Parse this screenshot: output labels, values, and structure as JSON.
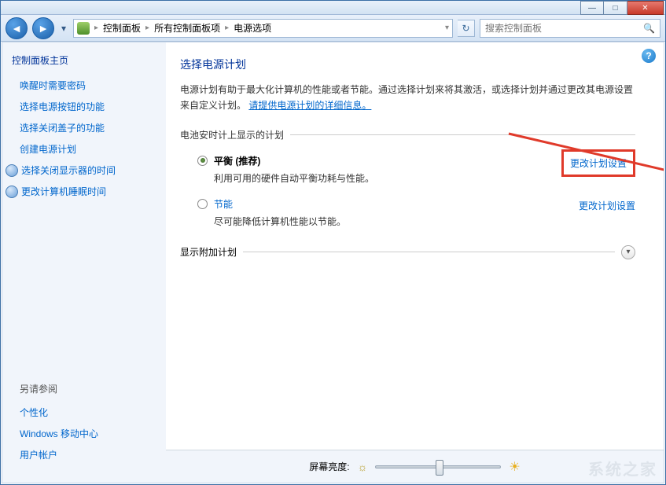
{
  "titlebar": {
    "min_tip": "最小化",
    "max_tip": "最大化",
    "close_tip": "关闭"
  },
  "nav": {
    "back_tip": "后退",
    "fwd_tip": "前进",
    "crumb1": "控制面板",
    "crumb2": "所有控制面板项",
    "crumb3": "电源选项",
    "search_placeholder": "搜索控制面板"
  },
  "sidebar": {
    "home": "控制面板主页",
    "links": [
      "唤醒时需要密码",
      "选择电源按钮的功能",
      "选择关闭盖子的功能",
      "创建电源计划",
      "选择关闭显示器的时间",
      "更改计算机睡眠时间"
    ],
    "seealso_title": "另请参阅",
    "seealso": [
      "个性化",
      "Windows 移动中心",
      "用户帐户"
    ]
  },
  "main": {
    "help_tip": "?",
    "title": "选择电源计划",
    "desc_1": "电源计划有助于最大化计算机的性能或者节能。通过选择计划来将其激活，或选择计划并通过更改其电源设置来自定义计划。",
    "desc_link": "请提供电源计划的详细信息。",
    "section_label": "电池安时计上显示的计划",
    "plans": [
      {
        "name": "平衡 (推荐)",
        "desc": "利用可用的硬件自动平衡功耗与性能。",
        "checked": true,
        "change": "更改计划设置"
      },
      {
        "name": "节能",
        "desc": "尽可能降低计算机性能以节能。",
        "checked": false,
        "change": "更改计划设置"
      }
    ],
    "expand_label": "显示附加计划",
    "brightness_label": "屏幕亮度:"
  },
  "watermark": "系统之家"
}
